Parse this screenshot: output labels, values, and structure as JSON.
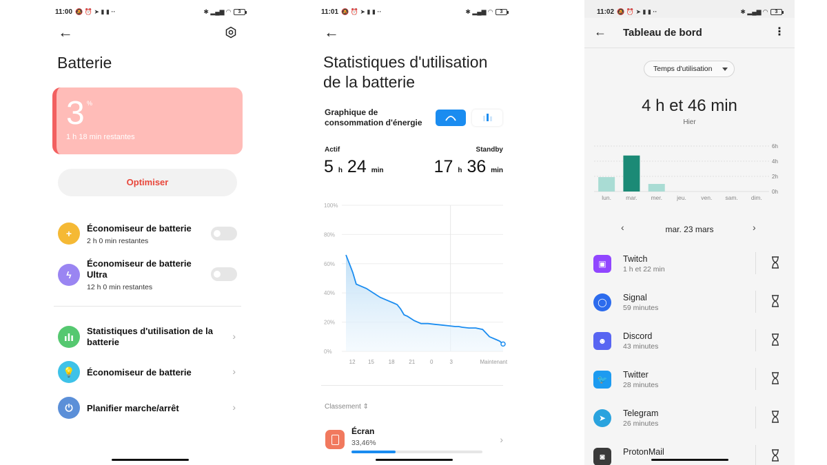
{
  "phone1": {
    "status": {
      "time": "11:00",
      "battery": "3"
    },
    "title": "Batterie",
    "battery_card": {
      "value": "3",
      "unit": "%",
      "remaining": "1 h 18 min restantes"
    },
    "optimize_label": "Optimiser",
    "toggles": [
      {
        "title": "Économiseur de batterie",
        "sub": "2 h 0 min restantes",
        "enabled": false
      },
      {
        "title": "Économiseur de batterie Ultra",
        "sub": "12 h 0 min restantes",
        "enabled": false
      }
    ],
    "links": [
      {
        "title": "Statistiques d'utilisation de la batterie"
      },
      {
        "title": "Économiseur de batterie"
      },
      {
        "title": "Planifier marche/arrêt"
      }
    ],
    "colors": {
      "card_bg": "#ffbcb8",
      "card_edge": "#f26060",
      "optimize": "#e8463a",
      "saver": "#f5b935",
      "ultra": "#9a85f2",
      "stats": "#55c870",
      "eco": "#3ec2e8",
      "schedule": "#5b8fd8"
    }
  },
  "phone2": {
    "status": {
      "time": "11:01",
      "battery": "3"
    },
    "title_line1": "Statistiques d'utilisation",
    "title_line2": "de la batterie",
    "graph_title_line1": "Graphique de",
    "graph_title_line2": "consommation d'énergie",
    "active": {
      "label": "Actif",
      "hours": "5",
      "h_unit": "h",
      "minutes": "24",
      "min_unit": "min"
    },
    "standby": {
      "label": "Standby",
      "hours": "17",
      "h_unit": "h",
      "minutes": "36",
      "min_unit": "min"
    },
    "chart_data": {
      "type": "area",
      "title": "",
      "xlabel": "",
      "ylabel": "",
      "y_ticks": [
        "100%",
        "80%",
        "60%",
        "40%",
        "20%",
        "0%"
      ],
      "x_ticks": [
        "12",
        "15",
        "18",
        "21",
        "0",
        "3",
        "Maintenant"
      ],
      "ylim": [
        0,
        100
      ],
      "grid": true,
      "series": [
        {
          "x": [
            0,
            0.5,
            1,
            1.5,
            2,
            3,
            4,
            5,
            5.5,
            6,
            7,
            7.5,
            8,
            8.5,
            9,
            10,
            11,
            12,
            13,
            14,
            15,
            16,
            16.5,
            17,
            18,
            19,
            20,
            21,
            22,
            22.5,
            23
          ],
          "y": [
            66,
            60,
            54,
            46,
            45,
            43,
            40,
            37,
            36,
            35,
            33,
            32,
            29,
            25,
            24,
            21,
            19,
            19,
            18.5,
            18,
            17.5,
            17,
            17,
            16.5,
            16,
            16,
            15,
            10,
            8,
            7,
            5
          ]
        }
      ]
    },
    "ranking_label": "Classement",
    "top_item": {
      "name": "Écran",
      "percent": "33,46%",
      "fraction": 0.3346
    }
  },
  "phone3": {
    "status": {
      "time": "11:02",
      "battery": "3"
    },
    "title": "Tableau de bord",
    "dropdown": "Temps d'utilisation",
    "total": "4 h et 46 min",
    "day": "Hier",
    "chart_data": {
      "type": "bar",
      "title": "",
      "categories": [
        "lun.",
        "mar.",
        "mer.",
        "jeu.",
        "ven.",
        "sam.",
        "dim."
      ],
      "values": [
        1.9,
        4.75,
        1.0,
        0,
        0,
        0,
        0
      ],
      "y_ticks": [
        "6h",
        "4h",
        "2h",
        "0h"
      ],
      "ylim": [
        0,
        6
      ],
      "highlight_index": 1,
      "colors": {
        "normal": "#a9dcd4",
        "highlight": "#1b8a76"
      }
    },
    "date": "mar. 23 mars",
    "apps": [
      {
        "name": "Twitch",
        "time": "1 h et 22 min",
        "color": "#9146ff",
        "icon": "twitch-icon"
      },
      {
        "name": "Signal",
        "time": "59 minutes",
        "color": "#2c6bed",
        "icon": "signal-icon"
      },
      {
        "name": "Discord",
        "time": "43 minutes",
        "color": "#5865f2",
        "icon": "discord-icon"
      },
      {
        "name": "Twitter",
        "time": "28 minutes",
        "color": "#1d9bf0",
        "icon": "twitter-icon"
      },
      {
        "name": "Telegram",
        "time": "26 minutes",
        "color": "#2aa3de",
        "icon": "telegram-icon"
      },
      {
        "name": "ProtonMail",
        "time": "",
        "color": "#3a3a3a",
        "icon": "protonmail-icon"
      }
    ]
  }
}
